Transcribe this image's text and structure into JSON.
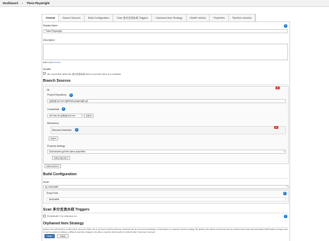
{
  "breadcrumb": {
    "dashboard": "Dashboard",
    "separator": "»",
    "job": "Theia Playwright"
  },
  "tabs": [
    {
      "label": "General",
      "active": true
    },
    {
      "label": "Branch Sources"
    },
    {
      "label": "Build Configuration"
    },
    {
      "label": "Scan 多分支流水线 Triggers"
    },
    {
      "label": "Orphaned Item Strategy"
    },
    {
      "label": "Health metrics"
    },
    {
      "label": "Properties"
    },
    {
      "label": "Pipeline Libraries"
    }
  ],
  "general": {
    "display_name_label": "Display Name",
    "display_name_value": "Theia Playwright",
    "description_label": "Description",
    "plain_text_label": "[Plain text]",
    "preview_link": "Preview",
    "disable_label": "Disable",
    "disable_checkbox_text": "(No new builds within this 多分支流水线 will be executed until it is re-enabled)"
  },
  "branch_sources": {
    "title": "Branch Sources",
    "git_label": "Git",
    "delete_label": "✕",
    "project_repository_label": "Project Repository",
    "project_repository_value": "git@git.tpl.com:/git/theia-playwright.git",
    "credentials_label": "Credentials",
    "credentials_value": "ssh key for git@git.tpl.com",
    "credentials_add_button": "Add ▾",
    "behaviours_label": "Behaviours",
    "discover_branches_label": "Discover branches",
    "add_button": "Add ▾",
    "property_strategy_label": "Property strategy",
    "property_strategy_value": "All branches get the same properties",
    "add_property_button": "Add property ▾",
    "add_source_button": "Add source ▾"
  },
  "build_configuration": {
    "title": "Build Configuration",
    "mode_label": "Mode",
    "mode_value": "by Jenkinsfile",
    "script_path_label": "Script Path",
    "script_path_value": "Jenkinsfile"
  },
  "scan_triggers": {
    "title": "Scan 多分支流水线 Triggers",
    "periodically_label": "Periodically if not otherwise run"
  },
  "orphaned": {
    "title": "Orphaned Item Strategy",
    "description": "Defines how old branches or tabs will be removed. When set to removed, branches that are orphaned can be removed immediately or kept based on a desired retention strategy. By default, jobs will be removed as soon as Jenkins determines that associated SCM heads no longer exist. It may be useful to configure a different retention strategy to be able to examine build results of a branch after it has been removed."
  },
  "footer": {
    "save_button": "Save",
    "apply_button": "Apply"
  },
  "colors": {
    "accent": "#4b79b5",
    "help": "#1f78c8",
    "delete": "#d9352b"
  }
}
